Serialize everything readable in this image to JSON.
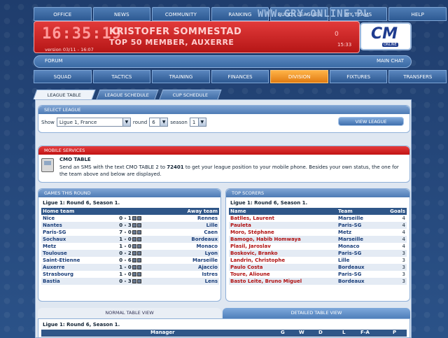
{
  "topnav": [
    "OFFICE",
    "NEWS",
    "COMMUNITY",
    "RANKING",
    "BUDDY LEAGUES",
    "MY TEAMS",
    "HELP"
  ],
  "watermark": "WWW.GRY-ONLINE.PL",
  "header": {
    "clock": "16:35:19",
    "version": "version 03/11 - 16:07",
    "name": "KRISTOFER SOMMESTAD",
    "subtitle": "TOP 50 MEMBER, AUXERRE",
    "count": "0",
    "time": "15:33"
  },
  "logo": {
    "text": "CM",
    "sub": "ONLINE"
  },
  "forumrow": {
    "forum": "FORUM",
    "mainchat": "MAIN CHAT"
  },
  "nav2": [
    "SQUAD",
    "TACTICS",
    "TRAINING",
    "FINANCES",
    "DIVISION",
    "FIXTURES",
    "TRANSFERS"
  ],
  "tabs": [
    "LEAGUE TABLE",
    "LEAGUE SCHEDULE",
    "CUP SCHEDULE"
  ],
  "select_league": {
    "header": "SELECT LEAGUE",
    "show_label": "Show",
    "league": "Ligue 1, France",
    "round_label": "round",
    "round": "6",
    "season_label": "season",
    "season": "1",
    "button": "VIEW LEAGUE"
  },
  "mobile": {
    "header": "MOBILE SERVICES",
    "title": "CMO TABLE",
    "text_before": "Send an SMS with the text CMO TABLE 2 to ",
    "number": "72401",
    "text_after": " to get your league position to your mobile phone. Besides your own status, the one for the team above and below are displayed."
  },
  "games": {
    "header": "GAMES THIS ROUND",
    "subtitle": "Ligue 1: Round 6, Season 1.",
    "col_home": "Home team",
    "col_away": "Away team",
    "rows": [
      [
        "Nice",
        "0 - 1",
        "Rennes"
      ],
      [
        "Nantes",
        "0 - 3",
        "Lille"
      ],
      [
        "Paris-SG",
        "7 - 0",
        "Caen"
      ],
      [
        "Sochaux",
        "1 - 0",
        "Bordeaux"
      ],
      [
        "Metz",
        "1 - 0",
        "Monaco"
      ],
      [
        "Toulouse",
        "0 - 2",
        "Lyon"
      ],
      [
        "Saint-Etienne",
        "0 - 6",
        "Marseille"
      ],
      [
        "Auxerre",
        "1 - 0",
        "Ajaccio"
      ],
      [
        "Strasbourg",
        "1 - 0",
        "Istres"
      ],
      [
        "Bastia",
        "0 - 3",
        "Lens"
      ]
    ]
  },
  "scorers": {
    "header": "TOP SCORERS",
    "subtitle": "Ligue 1: Round 6, Season 1.",
    "col_name": "Name",
    "col_team": "Team",
    "col_goals": "Goals",
    "rows": [
      [
        "Batlles, Laurent",
        "Marseille",
        "4"
      ],
      [
        "Pauleta",
        "Paris-SG",
        "4"
      ],
      [
        "Moro, Stéphane",
        "Metz",
        "4"
      ],
      [
        "Bamogo, Habib Homwaya",
        "Marseille",
        "4"
      ],
      [
        "Plasil, Jaroslav",
        "Monaco",
        "4"
      ],
      [
        "Boskovic, Branko",
        "Paris-SG",
        "3"
      ],
      [
        "Landrin, Christophe",
        "Lille",
        "3"
      ],
      [
        "Paulo Costa",
        "Bordeaux",
        "3"
      ],
      [
        "Toure, Alioune",
        "Paris-SG",
        "3"
      ],
      [
        "Basto Leite, Bruno Miguel",
        "Bordeaux",
        "3"
      ]
    ]
  },
  "table_view": {
    "normal": "NORMAL TABLE VIEW",
    "detailed": "DETAILED TABLE VIEW",
    "subtitle": "Ligue 1: Round 6, Season 1.",
    "cols": [
      "Manager",
      "G",
      "W",
      "D",
      "L",
      "F-A",
      "P"
    ]
  }
}
